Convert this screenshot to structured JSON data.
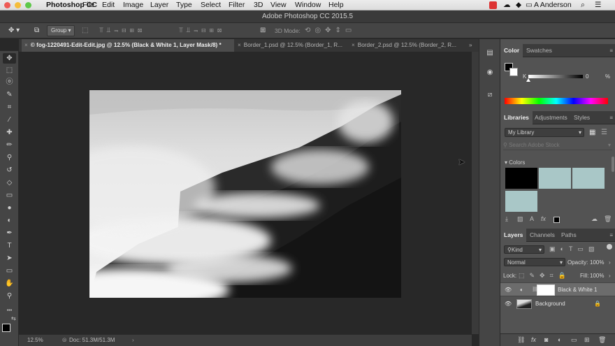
{
  "menubar": {
    "app_name": "Photoshop CC",
    "items": [
      "File",
      "Edit",
      "Image",
      "Layer",
      "Type",
      "Select",
      "Filter",
      "3D",
      "View",
      "Window",
      "Help"
    ],
    "user": "A Anderson"
  },
  "window": {
    "title": "Adobe Photoshop CC 2015.5"
  },
  "options_bar": {
    "group_label": "Group",
    "mode_label": "3D Mode:"
  },
  "tabs": [
    {
      "label": "© fog-1220491-Edit-Edit.jpg @ 12.5% (Black & White 1, Layer Mask/8) *",
      "active": true
    },
    {
      "label": "Border_1.psd @ 12.5% (Border_1, R...",
      "active": false
    },
    {
      "label": "Border_2.psd @ 12.5% (Border_2, R...",
      "active": false
    }
  ],
  "status": {
    "zoom": "12.5%",
    "doc": "Doc: 51.3M/51.3M"
  },
  "color_panel": {
    "tabs": [
      "Color",
      "Swatches"
    ],
    "slider_letter": "K",
    "value": "0",
    "unit": "%"
  },
  "libraries_panel": {
    "tabs": [
      "Libraries",
      "Adjustments",
      "Styles"
    ],
    "library_name": "My Library",
    "search_placeholder": "Search Adobe Stock",
    "section_title": "Colors",
    "swatches": [
      "#000000",
      "#a9c7c7",
      "#a9c7c7",
      "#a9c7c7"
    ]
  },
  "layers_panel": {
    "tabs": [
      "Layers",
      "Channels",
      "Paths"
    ],
    "filter_label": "Kind",
    "blend_mode": "Normal",
    "opacity_label": "Opacity:",
    "opacity_value": "100%",
    "lock_label": "Lock:",
    "fill_label": "Fill:",
    "fill_value": "100%",
    "layers": [
      {
        "name": "Black & White 1",
        "selected": true
      },
      {
        "name": "Background",
        "selected": false
      }
    ]
  },
  "colors": {
    "accent": "#5a8bd8",
    "panel_bg": "#535353"
  }
}
